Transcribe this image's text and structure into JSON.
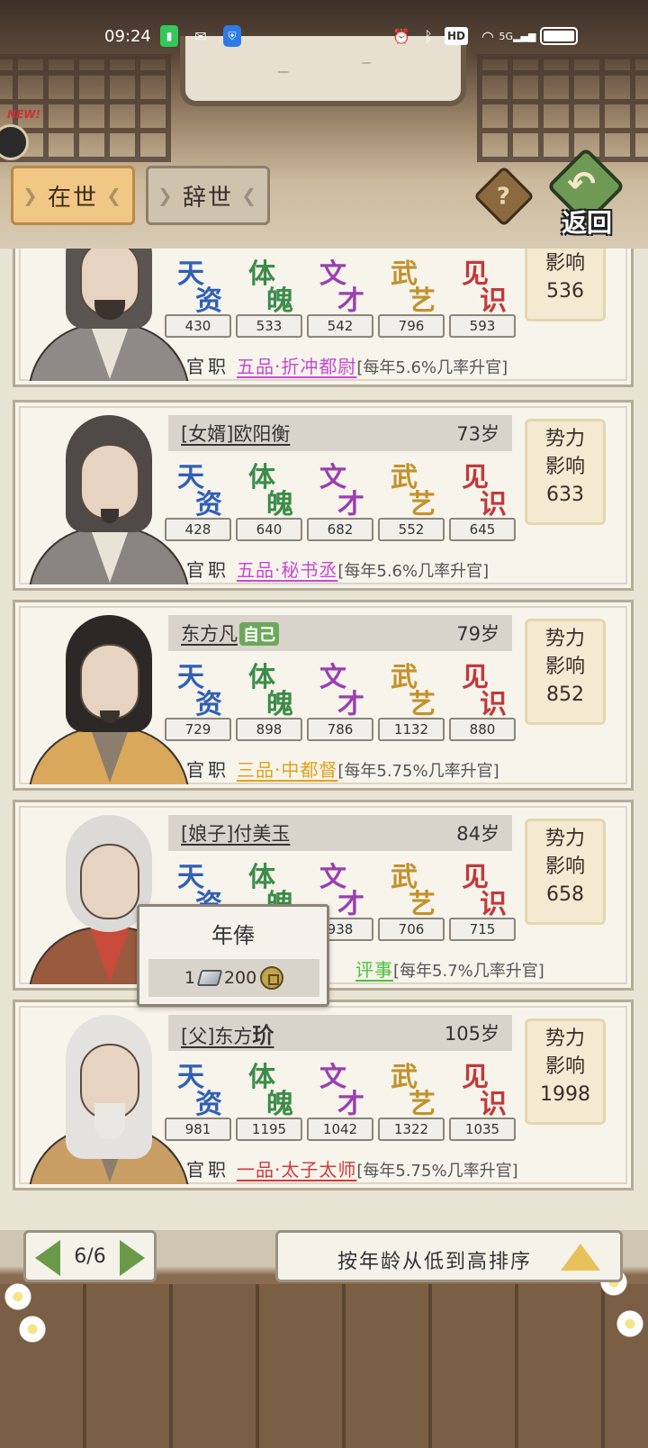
{
  "status_bar": {
    "time": "09:24",
    "hd": "HD",
    "signal": "5G"
  },
  "badge": {
    "new": "NEW!"
  },
  "tabs": [
    {
      "label": "在世",
      "active": true
    },
    {
      "label": "辞世",
      "active": false
    }
  ],
  "help": {
    "glyph": "?"
  },
  "back": {
    "arrow": "↶",
    "label": "返回"
  },
  "attr_labels": [
    {
      "c1": "天",
      "c2": "资",
      "color": "#2f5fb8"
    },
    {
      "c1": "体",
      "c2": "魄",
      "color": "#3c8c4a"
    },
    {
      "c1": "文",
      "c2": "才",
      "color": "#9a3fb0"
    },
    {
      "c1": "武",
      "c2": "艺",
      "color": "#c2922c"
    },
    {
      "c1": "见",
      "c2": "识",
      "color": "#c23a3a"
    }
  ],
  "office_label": "官职",
  "influence_label": {
    "l1": "势力",
    "l2": "影响"
  },
  "members": [
    {
      "name": "",
      "age": "",
      "stats": [
        "430",
        "533",
        "542",
        "796",
        "593"
      ],
      "rank": "五品·折冲都尉",
      "rank_color": "#c44bd1",
      "rate": "[每年5.6%几率升官]",
      "influence": "536",
      "hair": "#5a5550",
      "robe": "#8f8a86"
    },
    {
      "name": "[女婿]欧阳衡",
      "age": "73岁",
      "stats": [
        "428",
        "640",
        "682",
        "552",
        "645"
      ],
      "rank": "五品·秘书丞",
      "rank_color": "#c44bd1",
      "rate": "[每年5.6%几率升官]",
      "influence": "633",
      "hair": "#4f4a46",
      "robe": "#8a8580"
    },
    {
      "name": "东方凡",
      "self": "自己",
      "age": "79岁",
      "stats": [
        "729",
        "898",
        "786",
        "1132",
        "880"
      ],
      "rank": "三品·中都督",
      "rank_color": "#e0a21c",
      "rate": "[每年5.75%几率升官]",
      "influence": "852",
      "hair": "#2c2826",
      "robe": "#d9a85a"
    },
    {
      "name": "[娘子]付美玉",
      "age": "84岁",
      "stats": [
        "",
        "",
        "938",
        "706",
        "715"
      ],
      "rank": "评事",
      "rank_color": "#4fbf3a",
      "rate": "[每年5.7%几率升官]",
      "influence": "658",
      "hair": "#dcdad6",
      "robe": "#9a5a3e"
    },
    {
      "name_prefix": "[父]东方",
      "name_bold": "玠",
      "age": "105岁",
      "stats": [
        "981",
        "1195",
        "1042",
        "1322",
        "1035"
      ],
      "rank": "一品·太子太师",
      "rank_color": "#d23a3a",
      "rate": "[每年5.75%几率升官]",
      "influence": "1998",
      "hair": "#e4e2de",
      "robe": "#c89e64"
    }
  ],
  "tooltip": {
    "title": "年俸",
    "silver": "1",
    "coins": "200"
  },
  "pager": {
    "page": "6/6"
  },
  "sort": {
    "label": "按年龄从低到高排序"
  }
}
